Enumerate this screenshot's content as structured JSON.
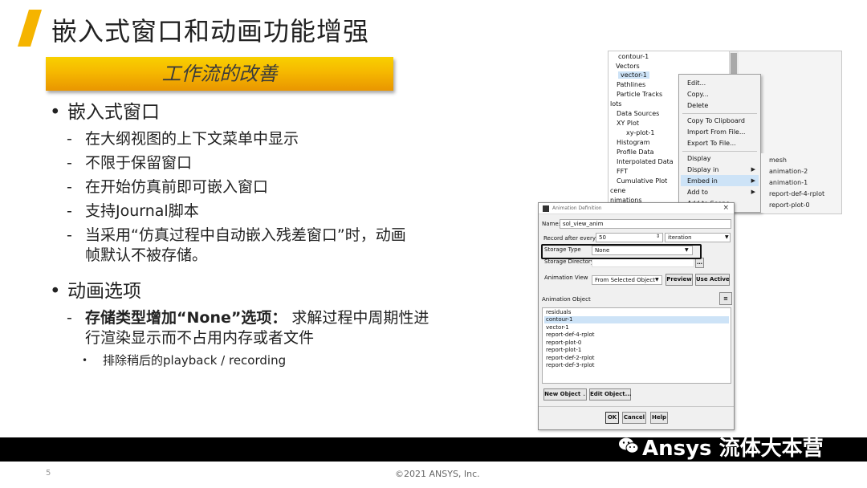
{
  "slide": {
    "title": "嵌入式窗口和动画功能增强",
    "banner": "工作流的改善",
    "bullets": [
      {
        "text": "嵌入式窗口",
        "subs": [
          "在大纲视图的上下文菜单中显示",
          "不限于保留窗口",
          "在开始仿真前即可嵌入窗口",
          "支持Journal脚本",
          "当采用“仿真过程中自动嵌入残差窗口”时，动画",
          "帧默认不被存储。"
        ]
      },
      {
        "text": "动画选项",
        "subs_bold": "存储类型增加“None”选项：",
        "subs_rest": "求解过程中周期性进",
        "subs_line2": "行渲染显示而不占用内存或者文件",
        "subsub": "排除稍后的playback / recording"
      }
    ],
    "page_number": "5",
    "copyright": "©2021 ANSYS, Inc.",
    "brand": "Ansys 流体大本营",
    "logo": "Ansys"
  },
  "tree": {
    "items": [
      "contour-1",
      "Vectors",
      "vector-1",
      "Pathlines",
      "Particle Tracks",
      "lots",
      "Data Sources",
      "XY Plot",
      "xy-plot-1",
      "Histogram",
      "Profile Data",
      "Interpolated Data",
      "FFT",
      "Cumulative Plot",
      "cene",
      "nimations"
    ]
  },
  "context_menu": {
    "items": [
      "Edit...",
      "Copy...",
      "Delete",
      "Copy To Clipboard",
      "Import From File...",
      "Export To File...",
      "Display",
      "Display in",
      "Embed in",
      "Add to",
      "Add to Scene"
    ],
    "submenu": [
      "mesh",
      "animation-2",
      "animation-1",
      "report-def-4-rplot",
      "report-plot-0"
    ]
  },
  "dialog": {
    "title": "Animation Definition",
    "name_label": "Name:",
    "name_value": "sol_view_anim",
    "record_label": "Record after every",
    "record_value": "50",
    "record_unit": "iteration",
    "storage_label": "Storage Type",
    "storage_value": "None",
    "directory_label": "Storage Directory",
    "view_label": "Animation View",
    "view_value": "From Selected Object",
    "preview": "Preview",
    "use_active": "Use Active",
    "object_label": "Animation Object",
    "objects": [
      "residuals",
      "contour-1",
      "vector-1",
      "report-def-4-rplot",
      "report-plot-0",
      "report-plot-1",
      "report-def-2-rplot",
      "report-def-3-rplot"
    ],
    "new_object": "New Object",
    "edit_object": "Edit Object...",
    "ok": "OK",
    "cancel": "Cancel",
    "help": "Help"
  },
  "colors": {
    "accent": "#f5b400",
    "footer": "#000000"
  }
}
